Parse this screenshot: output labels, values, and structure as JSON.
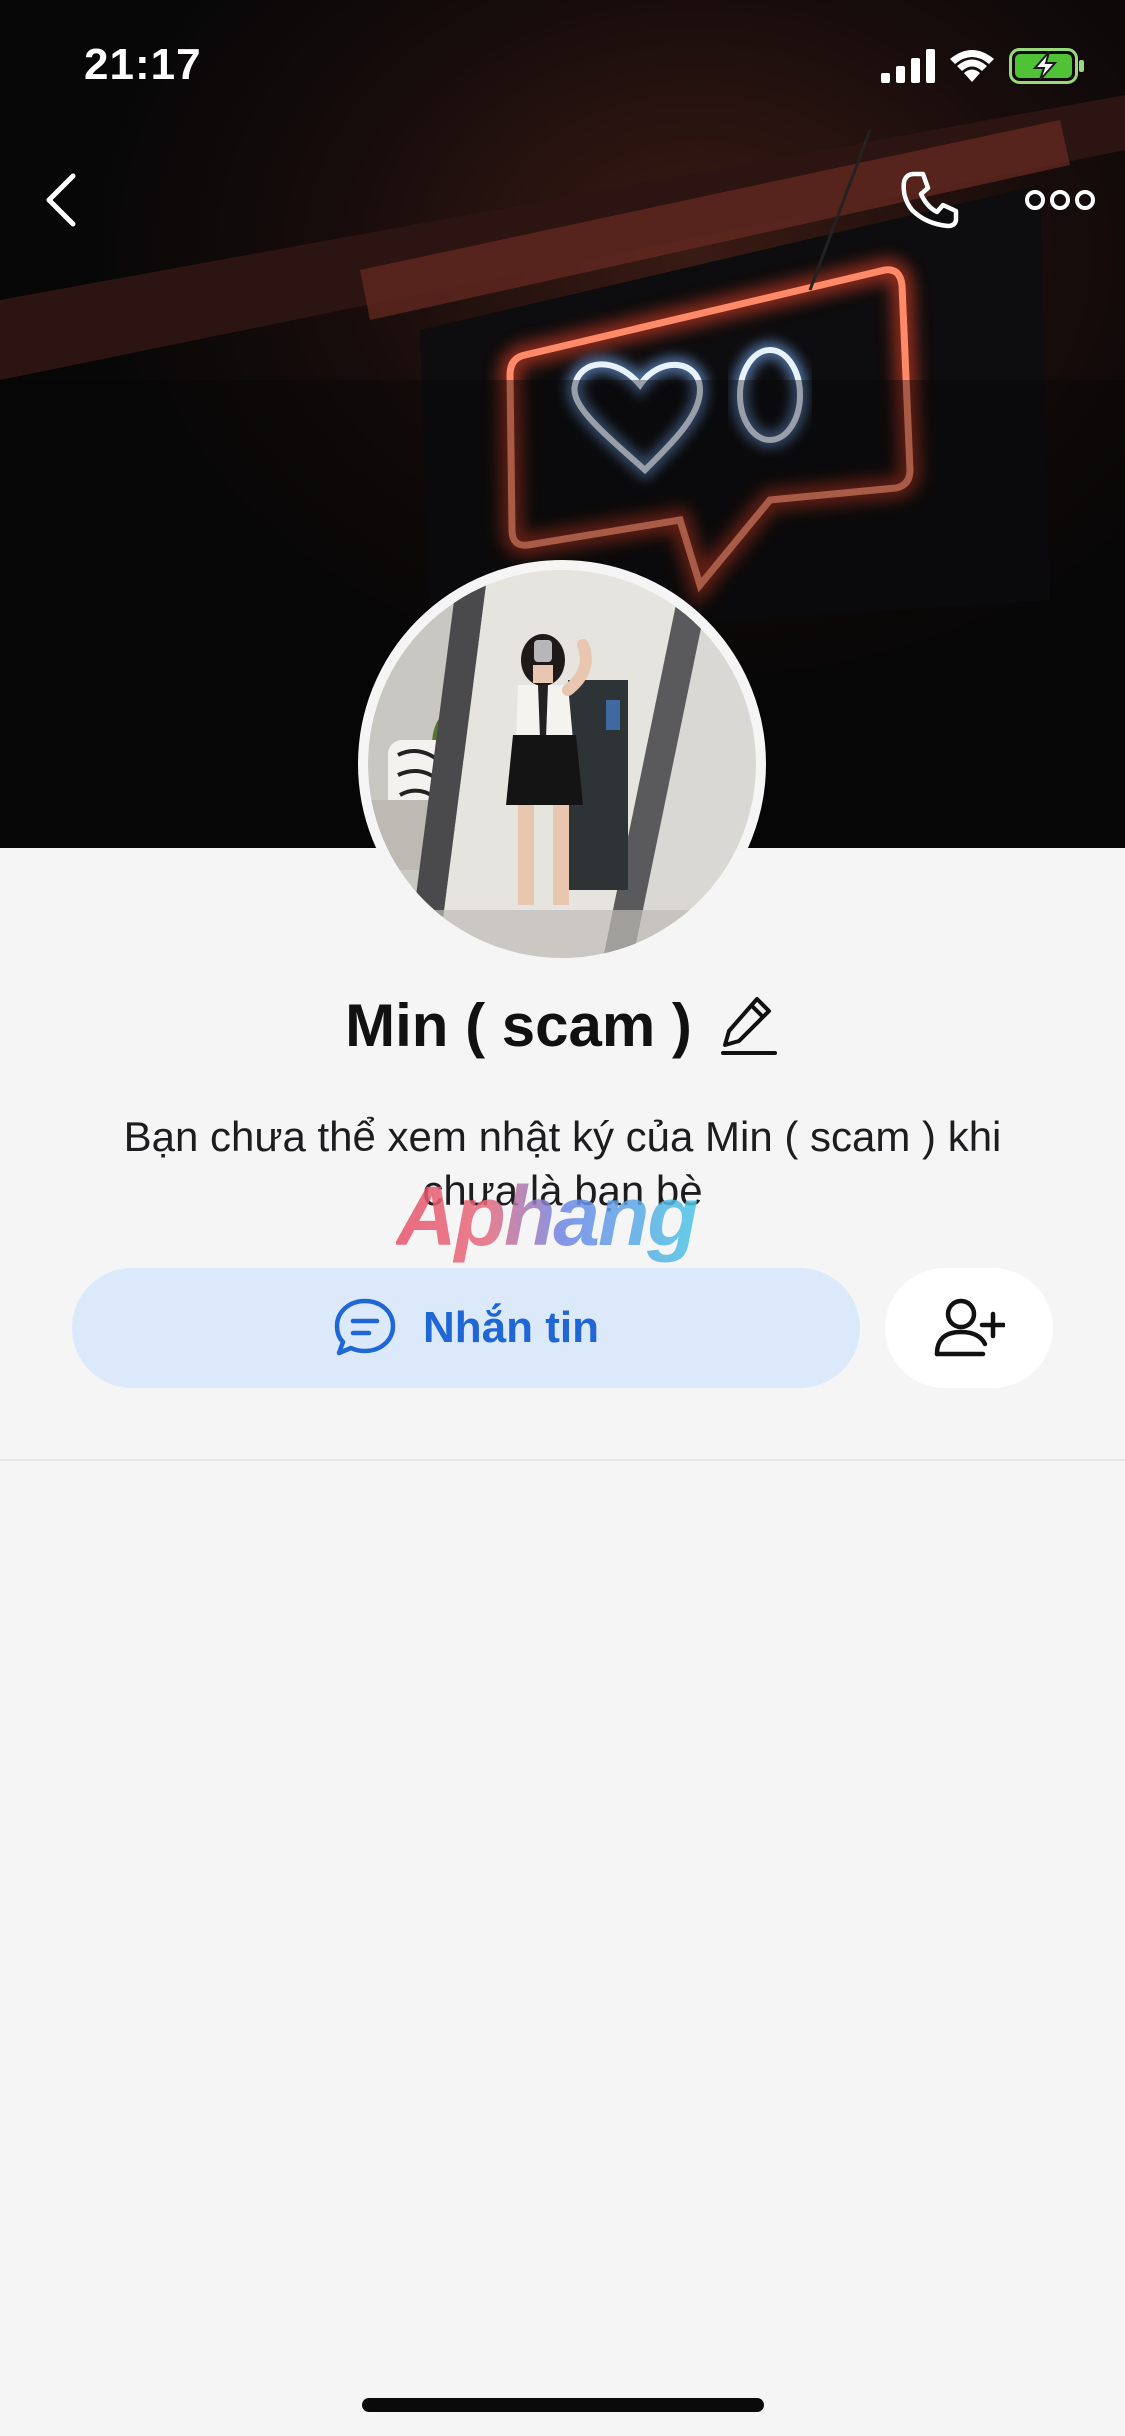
{
  "status_bar": {
    "time": "21:17"
  },
  "header": {
    "back_icon": "chevron-left-icon",
    "call_icon": "phone-icon",
    "more_icon": "ellipsis-icon"
  },
  "cover": {
    "neon_digit": "0",
    "neon_color": "#ff5a3c"
  },
  "profile": {
    "name": "Min ( scam )",
    "notice": "Bạn chưa thể xem nhật ký của Min ( scam ) khi chưa là bạn bè",
    "watermark": "Aphang"
  },
  "actions": {
    "message_label": "Nhắn tin",
    "message_icon": "chat-bubble-icon",
    "add_friend_icon": "add-friend-icon"
  },
  "colors": {
    "accent": "#1f66d6",
    "message_button_bg": "#dce9fb",
    "page_bg": "#f4f5f4"
  }
}
